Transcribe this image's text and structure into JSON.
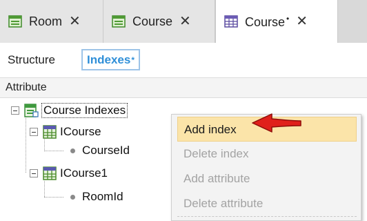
{
  "tabs": [
    {
      "label": "Room",
      "icon": "transaction-form-icon",
      "active": false,
      "modified": false
    },
    {
      "label": "Course",
      "icon": "transaction-form-icon",
      "active": false,
      "modified": false
    },
    {
      "label": "Course",
      "icon": "table-grid-icon",
      "active": true,
      "modified": true
    }
  ],
  "tab_close_glyph": "✕",
  "modified_marker": "•",
  "subtabs": {
    "structure": "Structure",
    "indexes": "Indexes",
    "indexes_modified": "*"
  },
  "header": {
    "attribute": "Attribute"
  },
  "tree": {
    "root": {
      "label": "Course Indexes",
      "icon": "indexes-icon"
    },
    "indexes": [
      {
        "label": "ICourse",
        "icon": "index-icon",
        "attributes": [
          "CourseId"
        ]
      },
      {
        "label": "ICourse1",
        "icon": "index-icon",
        "attributes": [
          "RoomId"
        ]
      }
    ]
  },
  "context_menu": {
    "items": [
      {
        "label": "Add index",
        "enabled": true,
        "highlighted": true
      },
      {
        "label": "Delete index",
        "enabled": false,
        "highlighted": false
      },
      {
        "label": "Add attribute",
        "enabled": false,
        "highlighted": false
      },
      {
        "label": "Delete attribute",
        "enabled": false,
        "highlighted": false
      }
    ]
  },
  "colors": {
    "accent": "#2f8fd8",
    "menu_highlight": "#fbe4a9",
    "disabled_text": "#a3a3a3",
    "arrow": "#e0201b"
  }
}
